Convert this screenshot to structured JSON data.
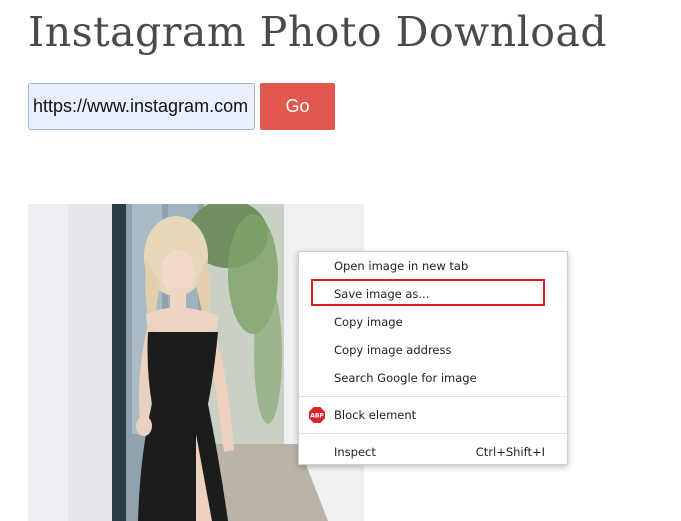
{
  "page": {
    "title": "Instagram Photo Download"
  },
  "form": {
    "url_value": "https://www.instagram.com",
    "go_label": "Go"
  },
  "context_menu": {
    "items": [
      {
        "label": "Open image in new tab",
        "shortcut": ""
      },
      {
        "label": "Save image as...",
        "shortcut": "",
        "highlighted": true
      },
      {
        "label": "Copy image",
        "shortcut": ""
      },
      {
        "label": "Copy image address",
        "shortcut": ""
      },
      {
        "label": "Search Google for image",
        "shortcut": ""
      },
      {
        "label": "Block element",
        "shortcut": "",
        "icon": "adblock-plus-icon",
        "icon_text": "ABP"
      },
      {
        "label": "Inspect",
        "shortcut": "Ctrl+Shift+I"
      }
    ],
    "highlight_color": "#d21f1f"
  },
  "colors": {
    "go_button": "#e0584e",
    "input_background": "#e8f0fe",
    "title_text": "#4a4a4a"
  }
}
